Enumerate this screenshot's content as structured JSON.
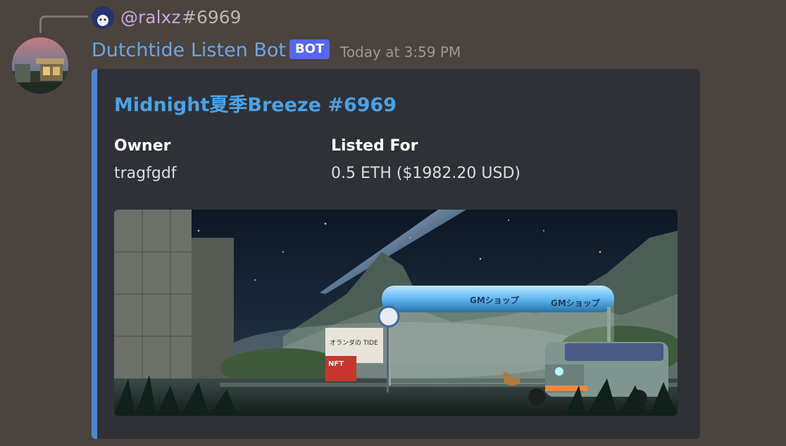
{
  "reply": {
    "username": "@ralxz",
    "text": "#6969"
  },
  "message": {
    "author": "Dutchtide Listen Bot",
    "bot_tag": "BOT",
    "timestamp": "Today at 3:59 PM"
  },
  "embed": {
    "title": "Midnight夏季Breeze #6969",
    "accent_color": "#4a87d3",
    "fields": [
      {
        "name": "Owner",
        "value": "tragfgdf"
      },
      {
        "name": "Listed For",
        "value": "0.5 ETH ($1982.20 USD)"
      }
    ],
    "image": {
      "bus_stop_sign_text": [
        "GMショップ",
        "GMショップ"
      ],
      "billboard_text": "オランダの TIDE",
      "nft_sign_text": "NFT"
    }
  },
  "colors": {
    "background": "#4a433e",
    "embed_bg": "#2f3136",
    "author": "#6aa6e8",
    "bot_tag": "#5865f2"
  }
}
